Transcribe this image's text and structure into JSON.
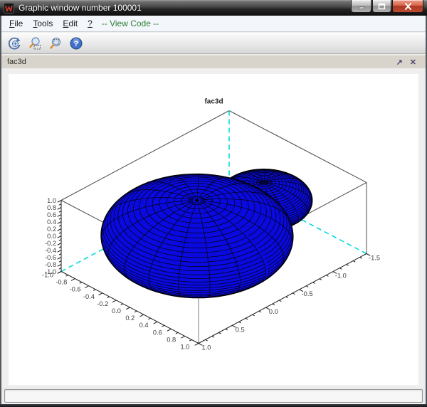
{
  "window": {
    "title": "Graphic window number 100001"
  },
  "menubar": {
    "items": [
      {
        "accel": "F",
        "rest": "ile"
      },
      {
        "accel": "T",
        "rest": "ools"
      },
      {
        "accel": "E",
        "rest": "dit"
      },
      {
        "accel": "?",
        "rest": ""
      }
    ],
    "view_code": "-- View Code --"
  },
  "toolbar": {
    "buttons": [
      {
        "name": "rotate"
      },
      {
        "name": "zoom-area"
      },
      {
        "name": "unzoom"
      },
      {
        "name": "help",
        "glyph": "?"
      }
    ]
  },
  "tab": {
    "label": "fac3d",
    "undock_glyph": "↗",
    "close_glyph": "✕"
  },
  "statusbar": {
    "text": ""
  },
  "plot": {
    "title": "fac3d",
    "colors": {
      "surface": "#0a0ae0",
      "wire": "#000000",
      "hidden_edge": "#00dcdc",
      "box": "#4a4a4a",
      "front_edge": "#7a7a7a",
      "axis": "#1a1a1a",
      "label": "#3d3d3d",
      "title": "#222222"
    },
    "projection": {
      "origin": [
        276.9,
        331.6
      ],
      "ex": [
        96.5,
        50.5
      ],
      "ey": [
        -94.4,
        50.4
      ],
      "ez": [
        0,
        -50
      ]
    },
    "axes": {
      "x": {
        "range": [
          -1,
          1
        ],
        "labels": [
          "-1.0",
          "-0.8",
          "-0.6",
          "-0.4",
          "-0.2",
          "0.0",
          "0.2",
          "0.4",
          "0.6",
          "0.8",
          "1.0"
        ],
        "minor_ticks": 20,
        "major_every": 2
      },
      "y": {
        "range": [
          1,
          -1.5
        ],
        "labels": [
          "1.0",
          "0.5",
          "0.0",
          "-0.5",
          "-1.0",
          "-1.5"
        ],
        "minor_ticks": 25,
        "major_every": 5
      },
      "z": {
        "range": [
          -1,
          1
        ],
        "labels": [
          "1.0",
          "0.8",
          "0.6",
          "0.4",
          "0.2",
          "0.0",
          "-0.2",
          "-0.4",
          "-0.6",
          "-0.8",
          "-1.0"
        ],
        "minor_ticks": 20,
        "major_every": 2
      }
    },
    "spheres": [
      {
        "name": "small-sphere",
        "center": [
          0,
          -1,
          0
        ],
        "radius": 0.5,
        "n_lat": 40,
        "n_lon": 20
      },
      {
        "name": "large-sphere",
        "center": [
          0,
          0,
          0
        ],
        "radius": 1.0,
        "n_lat": 40,
        "n_lon": 20
      }
    ]
  }
}
